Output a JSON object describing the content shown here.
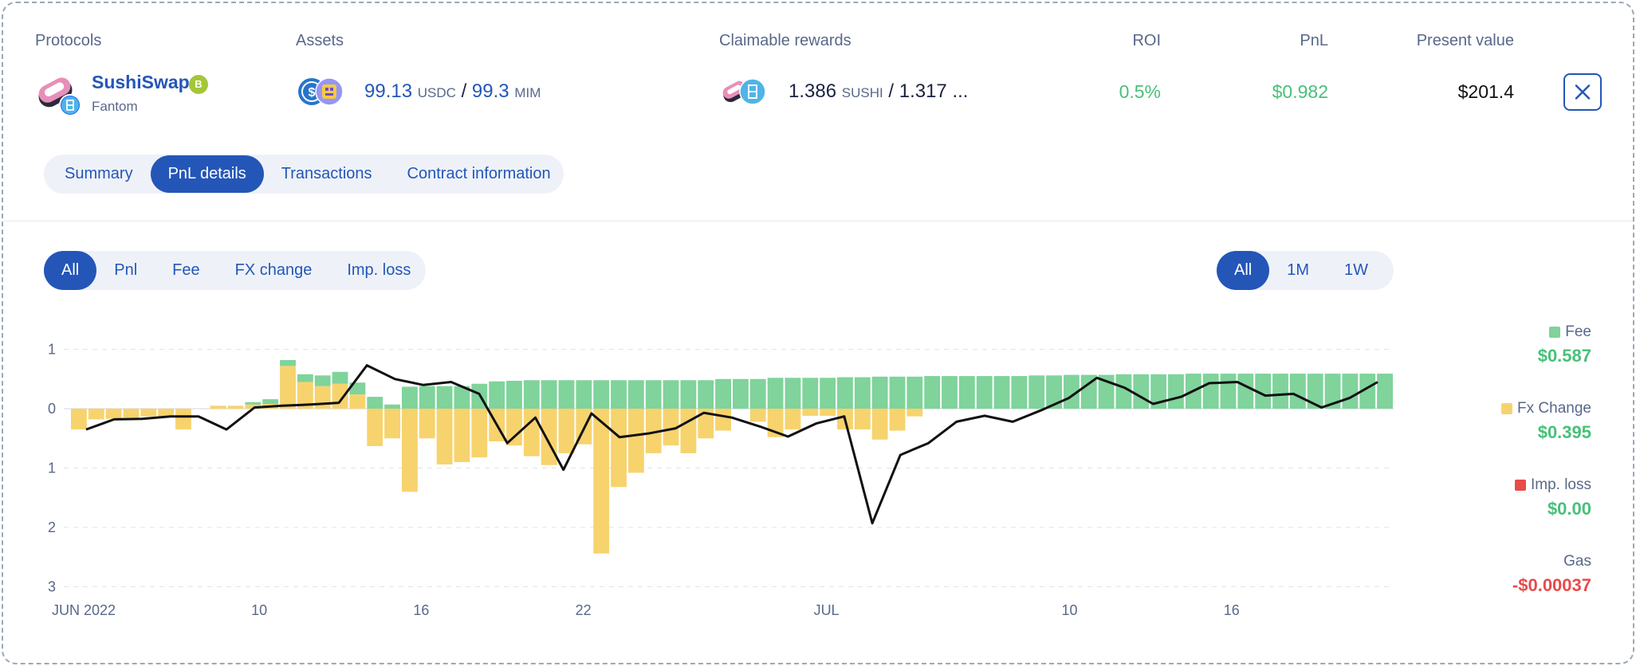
{
  "header": {
    "protocols": "Protocols",
    "assets": "Assets",
    "claimable_rewards": "Claimable rewards",
    "roi": "ROI",
    "pnl": "PnL",
    "present_value": "Present value"
  },
  "position": {
    "protocol_name": "SushiSwap",
    "protocol_badge": "B",
    "chain": "Fantom",
    "asset1_amount": "99.13",
    "asset1_symbol": "USDC",
    "asset2_amount": "99.3",
    "asset2_symbol": "MIM",
    "reward1_amount": "1.386",
    "reward1_symbol": "SUSHI",
    "reward2_amount": "1.317 ...",
    "roi": "0.5%",
    "pnl": "$0.982",
    "present_value": "$201.4",
    "slash": "/"
  },
  "tabs": [
    "Summary",
    "PnL details",
    "Transactions",
    "Contract information"
  ],
  "active_tab": 1,
  "filters": [
    "All",
    "Pnl",
    "Fee",
    "FX change",
    "Imp. loss"
  ],
  "ranges": [
    "All",
    "1M",
    "1W"
  ],
  "legend": {
    "fee_label": "Fee",
    "fee_value": "$0.587",
    "fx_label": "Fx Change",
    "fx_value": "$0.395",
    "imp_label": "Imp. loss",
    "imp_value": "$0.00",
    "gas_label": "Gas",
    "gas_value": "-$0.00037"
  },
  "colors": {
    "accent": "#2456b8",
    "fee": "#7fd39b",
    "fx": "#f7d36e",
    "imp": "#e84b4b",
    "positive": "#49c07a",
    "negative": "#e84b4b"
  },
  "icons": {
    "protocol": "sushi-logo-icon",
    "chain": "fantom-icon",
    "asset1": "usdc-icon",
    "asset2": "mim-icon",
    "reward1": "sushi-icon",
    "reward2": "fantom-icon",
    "close": "close-icon"
  },
  "chart_data": {
    "type": "bar",
    "y_tick_labels": [
      "1",
      "0",
      "1",
      "2",
      "3"
    ],
    "y_ticks": [
      1,
      0,
      -1,
      -2,
      -3
    ],
    "ylim": [
      -3,
      1
    ],
    "x_tick_labels": [
      {
        "label": "JUN 2022",
        "index": 0
      },
      {
        "label": "10",
        "index": 7
      },
      {
        "label": "16",
        "index": 13
      },
      {
        "label": "22",
        "index": 19
      },
      {
        "label": "JUL",
        "index": 28
      },
      {
        "label": "10",
        "index": 37
      },
      {
        "label": "16",
        "index": 43
      }
    ],
    "series": [
      {
        "name": "Fee",
        "values": [
          0,
          0,
          0,
          0,
          0,
          0,
          0,
          0,
          0,
          0,
          0.04,
          0.08,
          0.1,
          0.13,
          0.18,
          0.2,
          0.2,
          0.2,
          0.07,
          0.37,
          0.38,
          0.38,
          0.38,
          0.42,
          0.46,
          0.47,
          0.48,
          0.48,
          0.48,
          0.48,
          0.48,
          0.48,
          0.48,
          0.48,
          0.48,
          0.48,
          0.48,
          0.5,
          0.5,
          0.5,
          0.52,
          0.52,
          0.52,
          0.52,
          0.53,
          0.53,
          0.54,
          0.54,
          0.54,
          0.55,
          0.55,
          0.55,
          0.55,
          0.55,
          0.55,
          0.56,
          0.56,
          0.57,
          0.57,
          0.57,
          0.58,
          0.58,
          0.58,
          0.58,
          0.59,
          0.59,
          0.59,
          0.59,
          0.59,
          0.59,
          0.59,
          0.59,
          0.59,
          0.59,
          0.59,
          0.59
        ]
      },
      {
        "name": "Fx Change",
        "values": [
          -0.35,
          -0.18,
          -0.17,
          -0.15,
          -0.13,
          -0.14,
          -0.35,
          0,
          0.05,
          0.05,
          0.07,
          0.08,
          0.72,
          0.45,
          0.38,
          0.42,
          0.24,
          -0.63,
          -0.5,
          -1.4,
          -0.5,
          -0.94,
          -0.9,
          -0.82,
          -0.55,
          -0.62,
          -0.8,
          -0.95,
          -0.75,
          -0.6,
          -2.44,
          -1.32,
          -1.08,
          -0.75,
          -0.62,
          -0.75,
          -0.5,
          -0.37,
          0,
          -0.22,
          -0.48,
          -0.35,
          -0.12,
          -0.12,
          -0.35,
          -0.35,
          -0.52,
          -0.37,
          -0.13
        ]
      },
      {
        "name": "PnL",
        "values": [
          -0.35,
          -0.18,
          -0.17,
          -0.13,
          -0.13,
          -0.35,
          0.02,
          0.05,
          0.07,
          0.1,
          0.73,
          0.5,
          0.4,
          0.45,
          0.25,
          -0.58,
          -0.15,
          -1.03,
          -0.08,
          -0.48,
          -0.42,
          -0.33,
          -0.07,
          -0.15,
          -0.3,
          -0.47,
          -0.25,
          -0.13,
          -1.93,
          -0.78,
          -0.58,
          -0.22,
          -0.12,
          -0.22,
          -0.03,
          0.18,
          0.52,
          0.35,
          0.08,
          0.2,
          0.43,
          0.45,
          0.22,
          0.25,
          0.02,
          0.18,
          0.45
        ]
      }
    ],
    "legend": [
      "Fee",
      "Fx Change",
      "Imp. loss",
      "Gas"
    ],
    "grid": true
  }
}
